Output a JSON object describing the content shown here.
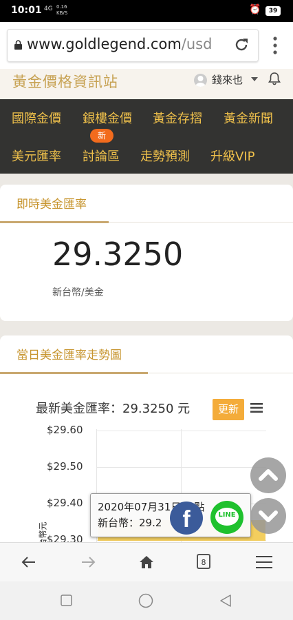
{
  "status_bar": {
    "time": "10:01",
    "signal": "4G",
    "net_speed_value": "0.16",
    "net_speed_unit": "KB/S",
    "battery": "39"
  },
  "browser": {
    "url_domain": "www.goldlegend.com",
    "url_path": "/usd",
    "tab_count": "8"
  },
  "site": {
    "title": "黃金價格資訊站",
    "username": "錢來也"
  },
  "nav": {
    "items": [
      "國際金價",
      "銀樓金價",
      "黃金存摺",
      "黃金新聞",
      "美元匯率",
      "討論區",
      "走勢預測",
      "升級VIP"
    ],
    "new_badge": "新"
  },
  "rate_card": {
    "title": "即時美金匯率",
    "rate": "29.3250",
    "unit": "新台幣/美金"
  },
  "chart_card": {
    "title": "當日美金匯率走勢圖",
    "chart_title": "最新美金匯率：29.3250 元",
    "update_label": "更新",
    "y_axis_label": "台幣元",
    "tooltip_line1": "2020年07月31日10點",
    "tooltip_line2": "新台幣：29.2"
  },
  "chart_data": {
    "type": "area",
    "title": "最新美金匯率：29.3250 元",
    "ylabel": "台幣元",
    "y_ticks": [
      "$29.60",
      "$29.50",
      "$29.40",
      "$29.30"
    ],
    "ylim": [
      29.3,
      29.6
    ],
    "grid": true
  },
  "social": {
    "facebook": "f",
    "line": "LINE"
  },
  "colors": {
    "gold": "#c7a253",
    "nav_bg": "#333331",
    "nav_text": "#f0c14b",
    "update": "#f4ac3a",
    "badge": "#f26b1d"
  }
}
